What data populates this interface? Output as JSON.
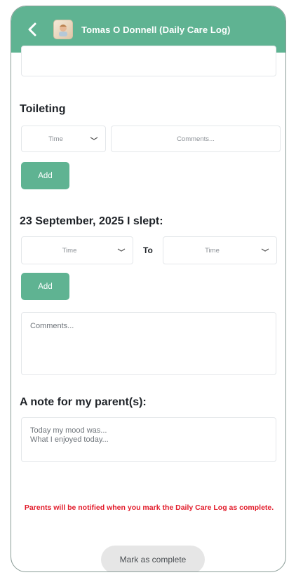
{
  "header": {
    "title": "Tomas O Donnell (Daily Care Log)",
    "back_icon": "chevron-left-icon",
    "avatar_icon": "child-avatar"
  },
  "toileting": {
    "title": "Toileting",
    "time_select": "Time",
    "comments_placeholder": "Comments...",
    "add_label": "Add"
  },
  "sleep": {
    "title": "23 September, 2025 I slept:",
    "from_select": "Time",
    "to_label": "To",
    "to_select": "Time",
    "add_label": "Add",
    "comments_placeholder": "Comments..."
  },
  "note": {
    "title": "A note for my parent(s):",
    "line1": "Today my mood was...",
    "line2": "What I enjoyed today..."
  },
  "footer": {
    "warning": "Parents will be notified when you mark the Daily Care Log as complete.",
    "complete_label": "Mark as complete"
  },
  "colors": {
    "accent": "#5fb392",
    "warning": "#e21b2a"
  }
}
